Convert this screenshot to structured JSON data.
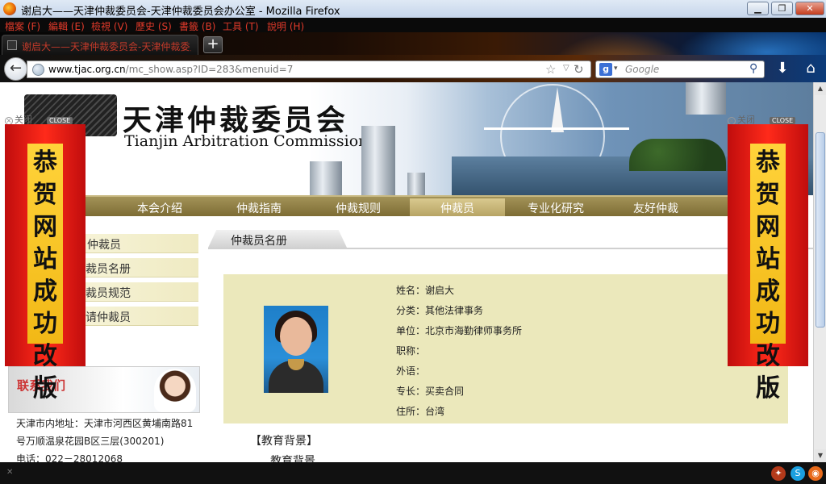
{
  "window": {
    "title": "谢启大——天津仲裁委员会-天津仲裁委员会办公室 - Mozilla Firefox",
    "controls": {
      "minimize": "▁",
      "maximize": "❐",
      "close": "✕"
    }
  },
  "menubar": {
    "items": [
      "檔案 (F)",
      "編輯 (E)",
      "檢視 (V)",
      "歷史 (S)",
      "書籤 (B)",
      "工具 (T)",
      "說明 (H)"
    ]
  },
  "tabs": [
    {
      "label": "谢启大——天津仲裁委员会-天津仲裁委员..."
    }
  ],
  "newtab_label": "+",
  "navigation": {
    "url_domain": "www.tjac.org.cn",
    "url_path": "/mc_show.asp?ID=283&menuid=7",
    "search_engine": "g",
    "search_placeholder": "Google"
  },
  "site": {
    "title_cn": "天津仲裁委员会",
    "title_en": "Tianjin Arbitration Commission"
  },
  "nav_menu": [
    {
      "label": "本会介绍",
      "active": false
    },
    {
      "label": "仲裁指南",
      "active": false
    },
    {
      "label": "仲裁规则",
      "active": false
    },
    {
      "label": "仲裁员",
      "active": true
    },
    {
      "label": "专业化研究",
      "active": false
    },
    {
      "label": "友好仲裁",
      "active": false
    }
  ],
  "side_menu": [
    "仲裁员",
    "仲裁员名册",
    "仲裁员规范",
    "申请仲裁员"
  ],
  "contact": {
    "heading": "联系我们",
    "address_line1": "天津市内地址：天津市河西区黄埔南路81",
    "address_line2": "号万顺温泉花园B区三层(300201)",
    "phone": "电话：022－28012068"
  },
  "section": {
    "title": "仲裁员名册"
  },
  "profile": {
    "fields": [
      {
        "label": "姓名：",
        "value": "谢启大"
      },
      {
        "label": "分类：",
        "value": "其他法律事务"
      },
      {
        "label": "单位：",
        "value": "北京市海勤律师事务所"
      },
      {
        "label": "职称：",
        "value": ""
      },
      {
        "label": "外语：",
        "value": ""
      },
      {
        "label": "专长：",
        "value": "买卖合同"
      },
      {
        "label": "住所：",
        "value": "台湾"
      }
    ]
  },
  "education": {
    "title": "【教育背景】",
    "subtitle": "教育背景"
  },
  "ads": {
    "close_text": "关闭",
    "close_badge": "CLOSE",
    "text": "恭贺网站成功改版"
  },
  "colors": {
    "nav_bg": "#8b7a40",
    "profile_bg": "#ebe8bb",
    "ad_red": "#e61e12",
    "ad_yellow": "#f5c22a"
  }
}
